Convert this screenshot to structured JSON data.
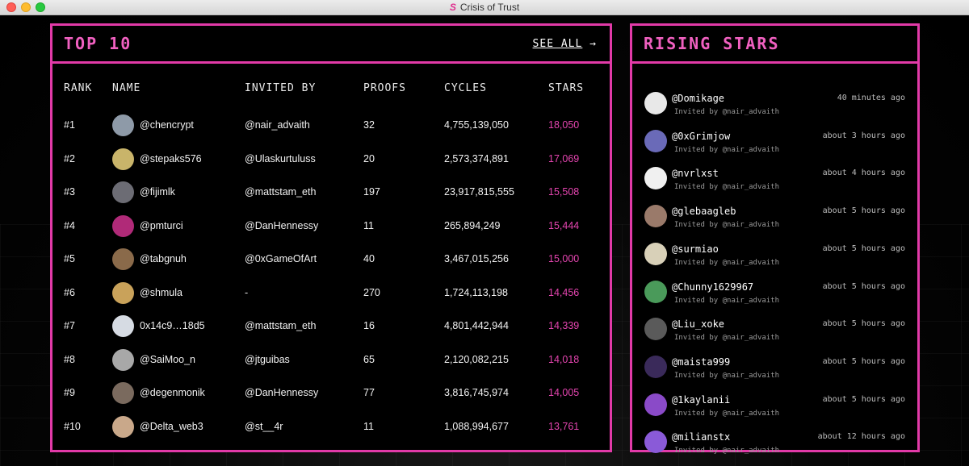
{
  "window": {
    "title": "Crisis of Trust",
    "logo_glyph": "S"
  },
  "top10": {
    "title": "TOP 10",
    "see_all": "SEE ALL",
    "see_all_arrow": "→",
    "headers": {
      "rank": "RANK",
      "name": "NAME",
      "invited_by": "INVITED BY",
      "proofs": "PROOFS",
      "cycles": "CYCLES",
      "stars": "STARS"
    },
    "rows": [
      {
        "rank": "#1",
        "name": "@chencrypt",
        "invited_by": "@nair_advaith",
        "proofs": "32",
        "cycles": "4,755,139,050",
        "stars": "18,050",
        "avatar_color": "#8e9aa8"
      },
      {
        "rank": "#2",
        "name": "@stepaks576",
        "invited_by": "@Ulaskurtuluss",
        "proofs": "20",
        "cycles": "2,573,374,891",
        "stars": "17,069",
        "avatar_color": "#c9b46a"
      },
      {
        "rank": "#3",
        "name": "@fijimlk",
        "invited_by": "@mattstam_eth",
        "proofs": "197",
        "cycles": "23,917,815,555",
        "stars": "15,508",
        "avatar_color": "#6c6c74"
      },
      {
        "rank": "#4",
        "name": "@pmturci",
        "invited_by": "@DanHennessy",
        "proofs": "11",
        "cycles": "265,894,249",
        "stars": "15,444",
        "avatar_color": "#b02a78"
      },
      {
        "rank": "#5",
        "name": "@tabgnuh",
        "invited_by": "@0xGameOfArt",
        "proofs": "40",
        "cycles": "3,467,015,256",
        "stars": "15,000",
        "avatar_color": "#8a6a4a"
      },
      {
        "rank": "#6",
        "name": "@shmula",
        "invited_by": "-",
        "proofs": "270",
        "cycles": "1,724,113,198",
        "stars": "14,456",
        "avatar_color": "#c9a25a"
      },
      {
        "rank": "#7",
        "name": "0x14c9…18d5",
        "invited_by": "@mattstam_eth",
        "proofs": "16",
        "cycles": "4,801,442,944",
        "stars": "14,339",
        "avatar_color": "#d6dbe3"
      },
      {
        "rank": "#8",
        "name": "@SaiMoo_n",
        "invited_by": "@jtguibas",
        "proofs": "65",
        "cycles": "2,120,082,215",
        "stars": "14,018",
        "avatar_color": "#a8a8a8"
      },
      {
        "rank": "#9",
        "name": "@degenmonik",
        "invited_by": "@DanHennessy",
        "proofs": "77",
        "cycles": "3,816,745,974",
        "stars": "14,005",
        "avatar_color": "#7a6a5e"
      },
      {
        "rank": "#10",
        "name": "@Delta_web3",
        "invited_by": "@st__4r",
        "proofs": "11",
        "cycles": "1,088,994,677",
        "stars": "13,761",
        "avatar_color": "#c9a88a"
      }
    ]
  },
  "rising": {
    "title": "RISING STARS",
    "items": [
      {
        "handle": "@Domikage",
        "invited": "Invited by @nair_advaith",
        "time": "40 minutes ago",
        "avatar_color": "#e8e8e8"
      },
      {
        "handle": "@0xGrimjow",
        "invited": "Invited by @nair_advaith",
        "time": "about 3 hours ago",
        "avatar_color": "#6a6ab8"
      },
      {
        "handle": "@nvrlxst",
        "invited": "Invited by @nair_advaith",
        "time": "about 4 hours ago",
        "avatar_color": "#f0f0f0"
      },
      {
        "handle": "@glebaagleb",
        "invited": "Invited by @nair_advaith",
        "time": "about 5 hours ago",
        "avatar_color": "#9a7a6a"
      },
      {
        "handle": "@surmiao",
        "invited": "Invited by @nair_advaith",
        "time": "about 5 hours ago",
        "avatar_color": "#d8d0b8"
      },
      {
        "handle": "@Chunny1629967",
        "invited": "Invited by @nair_advaith",
        "time": "about 5 hours ago",
        "avatar_color": "#4a9a5a"
      },
      {
        "handle": "@Liu_xoke",
        "invited": "Invited by @nair_advaith",
        "time": "about 5 hours ago",
        "avatar_color": "#5a5a5a"
      },
      {
        "handle": "@maista999",
        "invited": "Invited by @nair_advaith",
        "time": "about 5 hours ago",
        "avatar_color": "#3a2a5a"
      },
      {
        "handle": "@1kaylanii",
        "invited": "Invited by @nair_advaith",
        "time": "about 5 hours ago",
        "avatar_color": "#8a4ac8"
      },
      {
        "handle": "@milianstx",
        "invited": "Invited by @nair_advaith",
        "time": "about 12 hours ago",
        "avatar_color": "#8a5ad8"
      }
    ]
  },
  "colors": {
    "accent": "#e23aa8",
    "stars": "#e545b0"
  }
}
